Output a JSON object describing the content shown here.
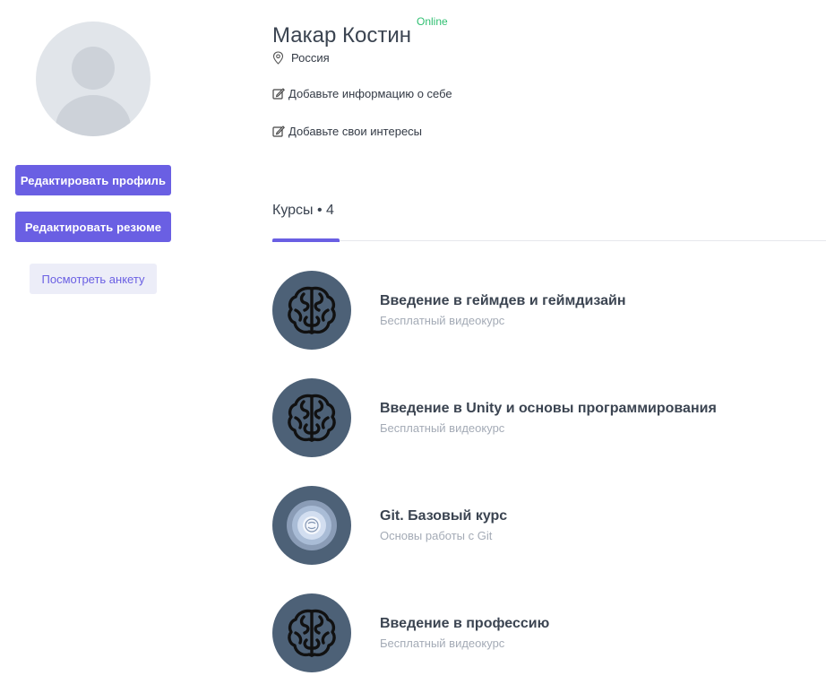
{
  "profile": {
    "name": "Макар Костин",
    "status": "Online",
    "location": "Россия",
    "add_about": "Добавьте информацию о себе",
    "add_interests": "Добавьте свои интересы"
  },
  "actions": {
    "edit_profile": "Редактировать профиль",
    "edit_resume": "Редактировать резюме",
    "view_profile": "Посмотреть анкету"
  },
  "tabs": [
    {
      "label": "Курсы • 4",
      "active": true
    }
  ],
  "courses": [
    {
      "title": "Введение в геймдев и геймдизайн",
      "subtitle": "Бесплатный видеокурс",
      "icon": "brain-icon"
    },
    {
      "title": "Введение в Unity и основы программирования",
      "subtitle": "Бесплатный видеокурс",
      "icon": "brain-icon"
    },
    {
      "title": "Git. Базовый курс",
      "subtitle": "Основы работы с Git",
      "icon": "git-glow-icon"
    },
    {
      "title": "Введение в профессию",
      "subtitle": "Бесплатный видеокурс",
      "icon": "brain-icon"
    }
  ],
  "colors": {
    "accent": "#6a5fe3",
    "online": "#2fbf71",
    "course_icon_bg": "#4d6177",
    "muted_text": "#a4abb6"
  }
}
